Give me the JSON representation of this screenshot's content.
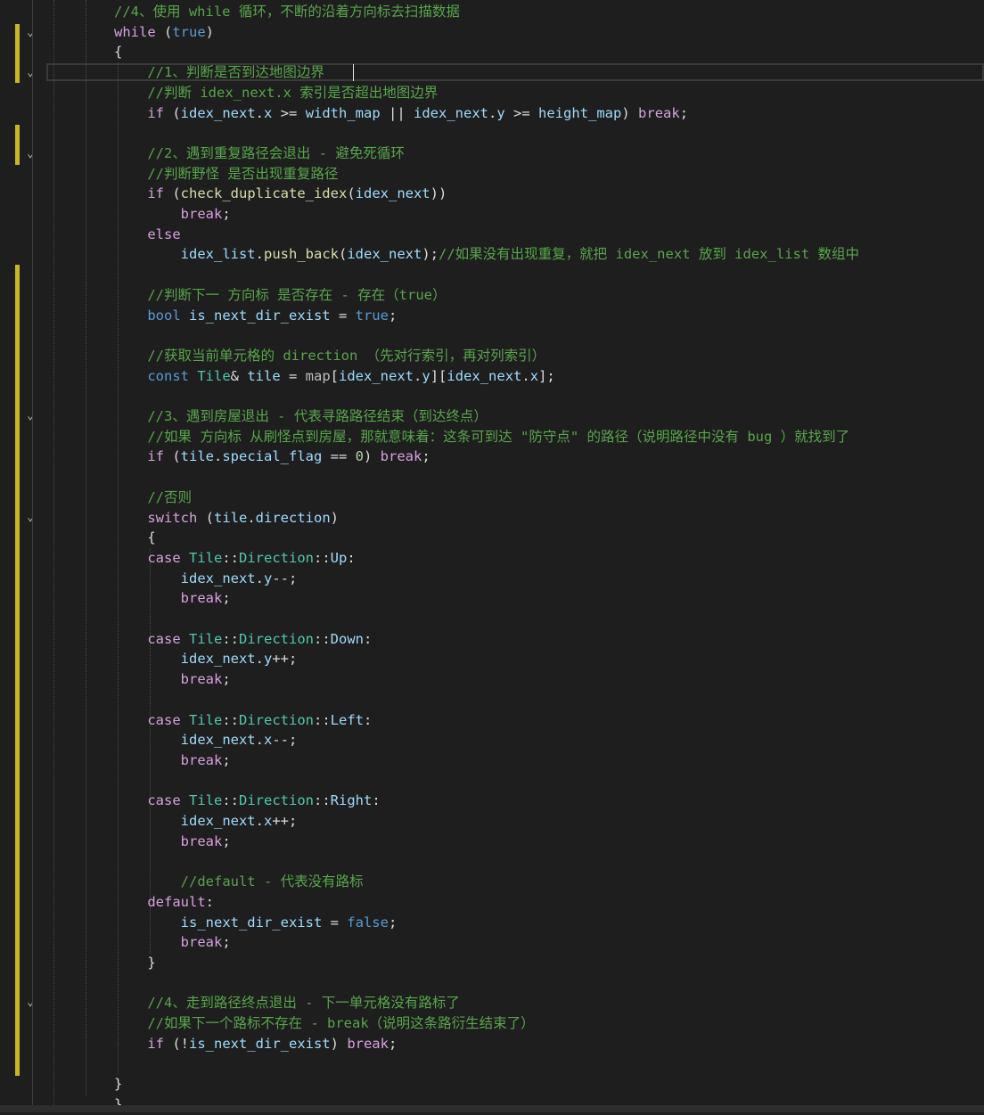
{
  "editor": {
    "lines": [
      [
        {
          "t": "//4、使用 while 循环，不断的沿着方向标去扫描数据",
          "c": "cm"
        }
      ],
      [
        {
          "t": "while",
          "c": "ctl"
        },
        {
          "t": " (",
          "c": "pl"
        },
        {
          "t": "true",
          "c": "kw"
        },
        {
          "t": ")",
          "c": "pl"
        }
      ],
      [
        {
          "t": "{",
          "c": "pl"
        }
      ],
      [
        {
          "t": "    //1、判断是否到达地图边界",
          "c": "cm"
        }
      ],
      [
        {
          "t": "    //判断 idex_next.x 索引是否超出地图边界",
          "c": "cm"
        }
      ],
      [
        {
          "t": "    if",
          "c": "ctl"
        },
        {
          "t": " (",
          "c": "pl"
        },
        {
          "t": "idex_next",
          "c": "var"
        },
        {
          "t": ".",
          "c": "pl"
        },
        {
          "t": "x",
          "c": "var"
        },
        {
          "t": " >= ",
          "c": "pl"
        },
        {
          "t": "width_map",
          "c": "var"
        },
        {
          "t": " || ",
          "c": "pl"
        },
        {
          "t": "idex_next",
          "c": "var"
        },
        {
          "t": ".",
          "c": "pl"
        },
        {
          "t": "y",
          "c": "var"
        },
        {
          "t": " >= ",
          "c": "pl"
        },
        {
          "t": "height_map",
          "c": "var"
        },
        {
          "t": ") ",
          "c": "pl"
        },
        {
          "t": "break",
          "c": "ctl"
        },
        {
          "t": ";",
          "c": "pl"
        }
      ],
      [],
      [
        {
          "t": "    //2、遇到重复路径会退出 - 避免死循环",
          "c": "cm"
        }
      ],
      [
        {
          "t": "    //判断野怪 是否出现重复路径",
          "c": "cm"
        }
      ],
      [
        {
          "t": "    if",
          "c": "ctl"
        },
        {
          "t": " (",
          "c": "pl"
        },
        {
          "t": "check_duplicate_idex",
          "c": "fn"
        },
        {
          "t": "(",
          "c": "pl"
        },
        {
          "t": "idex_next",
          "c": "var"
        },
        {
          "t": "))",
          "c": "pl"
        }
      ],
      [
        {
          "t": "        break",
          "c": "ctl"
        },
        {
          "t": ";",
          "c": "pl"
        }
      ],
      [
        {
          "t": "    else",
          "c": "ctl"
        }
      ],
      [
        {
          "t": "        ",
          "c": "pl"
        },
        {
          "t": "idex_list",
          "c": "var"
        },
        {
          "t": ".",
          "c": "pl"
        },
        {
          "t": "push_back",
          "c": "fn"
        },
        {
          "t": "(",
          "c": "pl"
        },
        {
          "t": "idex_next",
          "c": "var"
        },
        {
          "t": ");",
          "c": "pl"
        },
        {
          "t": "//如果没有出现重复，就把 idex_next 放到 idex_list 数组中",
          "c": "cm"
        }
      ],
      [],
      [
        {
          "t": "    //判断下一 方向标 是否存在 - 存在（true）",
          "c": "cm"
        }
      ],
      [
        {
          "t": "    bool",
          "c": "kw"
        },
        {
          "t": " ",
          "c": "pl"
        },
        {
          "t": "is_next_dir_exist",
          "c": "var"
        },
        {
          "t": " = ",
          "c": "pl"
        },
        {
          "t": "true",
          "c": "kw"
        },
        {
          "t": ";",
          "c": "pl"
        }
      ],
      [],
      [
        {
          "t": "    //获取当前单元格的 direction （先对行索引，再对列索引）",
          "c": "cm"
        }
      ],
      [
        {
          "t": "    const",
          "c": "kw"
        },
        {
          "t": " ",
          "c": "pl"
        },
        {
          "t": "Tile",
          "c": "ty"
        },
        {
          "t": "& ",
          "c": "pl"
        },
        {
          "t": "tile",
          "c": "var"
        },
        {
          "t": " = ",
          "c": "pl"
        },
        {
          "t": "map",
          "c": "mac"
        },
        {
          "t": "[",
          "c": "pl"
        },
        {
          "t": "idex_next",
          "c": "var"
        },
        {
          "t": ".",
          "c": "pl"
        },
        {
          "t": "y",
          "c": "var"
        },
        {
          "t": "][",
          "c": "pl"
        },
        {
          "t": "idex_next",
          "c": "var"
        },
        {
          "t": ".",
          "c": "pl"
        },
        {
          "t": "x",
          "c": "var"
        },
        {
          "t": "];",
          "c": "pl"
        }
      ],
      [],
      [
        {
          "t": "    //3、遇到房屋退出 - 代表寻路路径结束（到达终点）",
          "c": "cm"
        }
      ],
      [
        {
          "t": "    //如果 方向标 从刷怪点到房屋，那就意味着：这条可到达 \"防守点\" 的路径（说明路径中没有 bug ）就找到了",
          "c": "cm"
        }
      ],
      [
        {
          "t": "    if",
          "c": "ctl"
        },
        {
          "t": " (",
          "c": "pl"
        },
        {
          "t": "tile",
          "c": "var"
        },
        {
          "t": ".",
          "c": "pl"
        },
        {
          "t": "special_flag",
          "c": "var"
        },
        {
          "t": " == ",
          "c": "pl"
        },
        {
          "t": "0",
          "c": "num"
        },
        {
          "t": ") ",
          "c": "pl"
        },
        {
          "t": "break",
          "c": "ctl"
        },
        {
          "t": ";",
          "c": "pl"
        }
      ],
      [],
      [
        {
          "t": "    //否则",
          "c": "cm"
        }
      ],
      [
        {
          "t": "    switch",
          "c": "ctl"
        },
        {
          "t": " (",
          "c": "pl"
        },
        {
          "t": "tile",
          "c": "var"
        },
        {
          "t": ".",
          "c": "pl"
        },
        {
          "t": "direction",
          "c": "var"
        },
        {
          "t": ")",
          "c": "pl"
        }
      ],
      [
        {
          "t": "    {",
          "c": "pl"
        }
      ],
      [
        {
          "t": "    case",
          "c": "ctl"
        },
        {
          "t": " ",
          "c": "pl"
        },
        {
          "t": "Tile",
          "c": "ty"
        },
        {
          "t": "::",
          "c": "pl"
        },
        {
          "t": "Direction",
          "c": "ty"
        },
        {
          "t": "::",
          "c": "pl"
        },
        {
          "t": "Up",
          "c": "var"
        },
        {
          "t": ":",
          "c": "pl"
        }
      ],
      [
        {
          "t": "        ",
          "c": "pl"
        },
        {
          "t": "idex_next",
          "c": "var"
        },
        {
          "t": ".",
          "c": "pl"
        },
        {
          "t": "y",
          "c": "var"
        },
        {
          "t": "--;",
          "c": "pl"
        }
      ],
      [
        {
          "t": "        break",
          "c": "ctl"
        },
        {
          "t": ";",
          "c": "pl"
        }
      ],
      [],
      [
        {
          "t": "    case",
          "c": "ctl"
        },
        {
          "t": " ",
          "c": "pl"
        },
        {
          "t": "Tile",
          "c": "ty"
        },
        {
          "t": "::",
          "c": "pl"
        },
        {
          "t": "Direction",
          "c": "ty"
        },
        {
          "t": "::",
          "c": "pl"
        },
        {
          "t": "Down",
          "c": "var"
        },
        {
          "t": ":",
          "c": "pl"
        }
      ],
      [
        {
          "t": "        ",
          "c": "pl"
        },
        {
          "t": "idex_next",
          "c": "var"
        },
        {
          "t": ".",
          "c": "pl"
        },
        {
          "t": "y",
          "c": "var"
        },
        {
          "t": "++;",
          "c": "pl"
        }
      ],
      [
        {
          "t": "        break",
          "c": "ctl"
        },
        {
          "t": ";",
          "c": "pl"
        }
      ],
      [],
      [
        {
          "t": "    case",
          "c": "ctl"
        },
        {
          "t": " ",
          "c": "pl"
        },
        {
          "t": "Tile",
          "c": "ty"
        },
        {
          "t": "::",
          "c": "pl"
        },
        {
          "t": "Direction",
          "c": "ty"
        },
        {
          "t": "::",
          "c": "pl"
        },
        {
          "t": "Left",
          "c": "var"
        },
        {
          "t": ":",
          "c": "pl"
        }
      ],
      [
        {
          "t": "        ",
          "c": "pl"
        },
        {
          "t": "idex_next",
          "c": "var"
        },
        {
          "t": ".",
          "c": "pl"
        },
        {
          "t": "x",
          "c": "var"
        },
        {
          "t": "--;",
          "c": "pl"
        }
      ],
      [
        {
          "t": "        break",
          "c": "ctl"
        },
        {
          "t": ";",
          "c": "pl"
        }
      ],
      [],
      [
        {
          "t": "    case",
          "c": "ctl"
        },
        {
          "t": " ",
          "c": "pl"
        },
        {
          "t": "Tile",
          "c": "ty"
        },
        {
          "t": "::",
          "c": "pl"
        },
        {
          "t": "Direction",
          "c": "ty"
        },
        {
          "t": "::",
          "c": "pl"
        },
        {
          "t": "Right",
          "c": "var"
        },
        {
          "t": ":",
          "c": "pl"
        }
      ],
      [
        {
          "t": "        ",
          "c": "pl"
        },
        {
          "t": "idex_next",
          "c": "var"
        },
        {
          "t": ".",
          "c": "pl"
        },
        {
          "t": "x",
          "c": "var"
        },
        {
          "t": "++;",
          "c": "pl"
        }
      ],
      [
        {
          "t": "        break",
          "c": "ctl"
        },
        {
          "t": ";",
          "c": "pl"
        }
      ],
      [],
      [
        {
          "t": "        //default - 代表没有路标",
          "c": "cm"
        }
      ],
      [
        {
          "t": "    default",
          "c": "ctl"
        },
        {
          "t": ":",
          "c": "pl"
        }
      ],
      [
        {
          "t": "        ",
          "c": "pl"
        },
        {
          "t": "is_next_dir_exist",
          "c": "var"
        },
        {
          "t": " = ",
          "c": "pl"
        },
        {
          "t": "false",
          "c": "kw"
        },
        {
          "t": ";",
          "c": "pl"
        }
      ],
      [
        {
          "t": "        break",
          "c": "ctl"
        },
        {
          "t": ";",
          "c": "pl"
        }
      ],
      [
        {
          "t": "    }",
          "c": "pl"
        }
      ],
      [],
      [
        {
          "t": "    //4、走到路径终点退出 - 下一单元格没有路标了",
          "c": "cm"
        }
      ],
      [
        {
          "t": "    //如果下一个路标不存在 - break（说明这条路衍生结束了）",
          "c": "cm"
        }
      ],
      [
        {
          "t": "    if",
          "c": "ctl"
        },
        {
          "t": " (!",
          "c": "pl"
        },
        {
          "t": "is_next_dir_exist",
          "c": "var"
        },
        {
          "t": ") ",
          "c": "pl"
        },
        {
          "t": "break",
          "c": "ctl"
        },
        {
          "t": ";",
          "c": "pl"
        }
      ],
      [],
      [
        {
          "t": "}",
          "c": "pl"
        }
      ],
      [
        {
          "t": "}",
          "c": "pl"
        }
      ]
    ],
    "fold_icon": "chevron-down-icon"
  }
}
